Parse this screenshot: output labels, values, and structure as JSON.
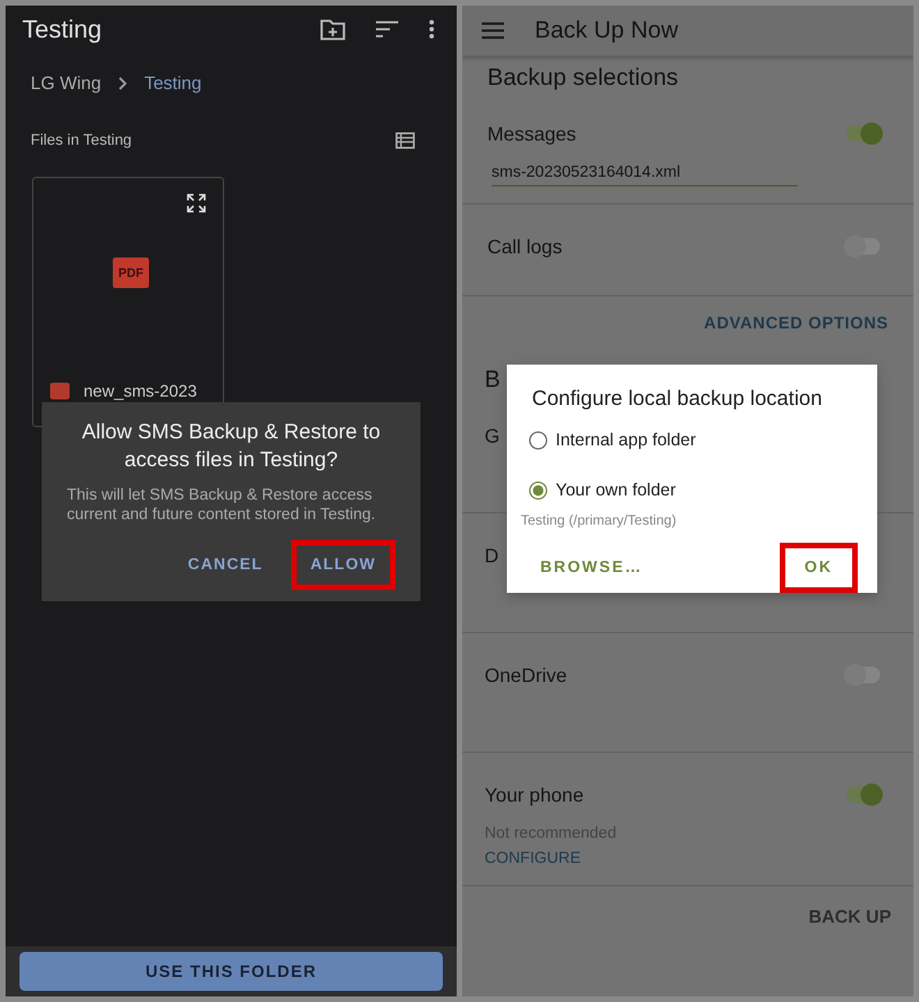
{
  "left_screen": {
    "title": "Testing",
    "breadcrumb": [
      {
        "label": "LG Wing",
        "selected": false
      },
      {
        "label": "Testing",
        "selected": true
      }
    ],
    "section_label": "Files in Testing",
    "files": [
      {
        "name": "new_sms-2023",
        "badge": "PDF"
      }
    ],
    "dialog": {
      "title": "Allow SMS Backup & Restore to access files in Testing?",
      "message": "This will let SMS Backup & Restore access current and future content stored in Testing.",
      "buttons": [
        {
          "label": "CANCEL",
          "highlighted": false
        },
        {
          "label": "ALLOW",
          "highlighted": true
        }
      ]
    },
    "primary_button": "USE THIS FOLDER"
  },
  "right_screen": {
    "title": "Back Up Now",
    "heading": "Backup selections",
    "items": [
      {
        "label": "Messages",
        "on": true,
        "field": "sms-20230523164014.xml"
      },
      {
        "label": "Call logs",
        "on": false
      }
    ],
    "advanced_link": "ADVANCED OPTIONS",
    "location_heading": "B",
    "locations": [
      {
        "label": "G"
      },
      {
        "label": "D"
      },
      {
        "label": "OneDrive",
        "on": false
      },
      {
        "label": "Your phone",
        "on": true,
        "note": "Not recommended",
        "link": "CONFIGURE"
      }
    ],
    "footer_button": "BACK UP",
    "dialog": {
      "title": "Configure local backup location",
      "options": [
        {
          "label": "Internal app folder",
          "selected": false
        },
        {
          "label": "Your own folder",
          "selected": true
        }
      ],
      "path": "Testing (/primary/Testing)",
      "buttons": [
        {
          "label": "BROWSE…",
          "highlighted": false
        },
        {
          "label": "OK",
          "highlighted": true
        }
      ]
    }
  }
}
